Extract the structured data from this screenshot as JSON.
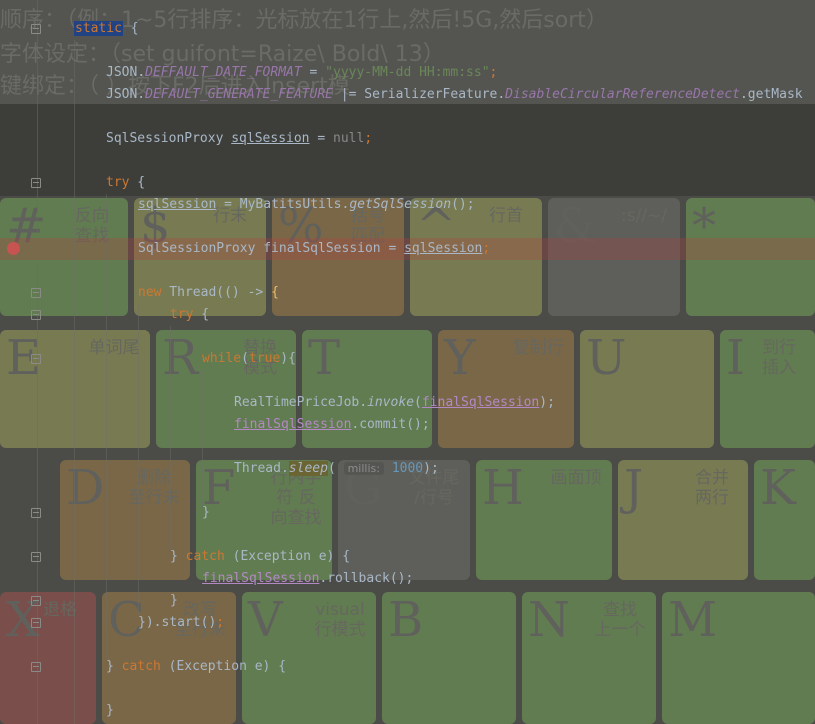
{
  "wallpaper": {
    "notes": [
      "顺序：（例：1~5行排序：光标放在1行上,然后!5G,然后sort）",
      "字体设定：（set guifont=Raize\\ Bold\\ 13）",
      "键绑定：（                                    ）按下F2后进入Insert模"
    ],
    "keys": [
      {
        "char": "#",
        "label": "反向 查找",
        "color": "k-green"
      },
      {
        "char": "$",
        "label": "行末",
        "color": "k-yellow"
      },
      {
        "char": "%",
        "label": "括号 匹配",
        "color": "k-orange"
      },
      {
        "char": "^",
        "label": "行首",
        "color": "k-yellow"
      },
      {
        "char": "&",
        "label": ":s//~/",
        "color": "k-gray"
      },
      {
        "char": "*",
        "label": "",
        "color": "k-green"
      },
      {
        "char": "E",
        "label": "单词尾",
        "color": "k-yellow"
      },
      {
        "char": "R",
        "label": "替换 模式",
        "color": "k-green"
      },
      {
        "char": "T",
        "label": "",
        "color": "k-green"
      },
      {
        "char": "Y",
        "label": "复制行",
        "color": "k-orange"
      },
      {
        "char": "U",
        "label": "",
        "color": "k-yellow"
      },
      {
        "char": "I",
        "label": "到行 插入",
        "color": "k-green"
      },
      {
        "char": "D",
        "label": "删除 至行末",
        "color": "k-orange"
      },
      {
        "char": "F",
        "label": "行内字符 反向查找",
        "color": "k-green"
      },
      {
        "char": "G",
        "label": "文件尾 /行号",
        "color": "k-gray"
      },
      {
        "char": "H",
        "label": "画面顶",
        "color": "k-green"
      },
      {
        "char": "J",
        "label": "合并 两行",
        "color": "k-yellow"
      },
      {
        "char": "K",
        "label": "",
        "color": "k-green"
      },
      {
        "char": "X",
        "label": "退格",
        "color": "k-red"
      },
      {
        "char": "C",
        "label": "改写 至行末",
        "color": "k-orange"
      },
      {
        "char": "V",
        "label": "visual 行模式",
        "color": "k-green"
      },
      {
        "char": "B",
        "label": "",
        "color": "k-green"
      },
      {
        "char": "N",
        "label": "查找 上一个",
        "color": "k-green"
      },
      {
        "char": "M",
        "label": "",
        "color": "k-green"
      }
    ]
  },
  "editor": {
    "code": {
      "static_kw": "static",
      "open_brace": " {",
      "l2_a": "JSON.",
      "l2_field": "DEFFAULT_DATE_FORMAT",
      "l2_b": " = ",
      "l2_str": "\"yyyy-MM-dd HH:mm:ss\"",
      "l2_c": ";",
      "l3_a": "JSON.",
      "l3_field": "DEFAULT_GENERATE_FEATURE",
      "l3_b": " |= SerializerFeature.",
      "l3_field2": "DisableCircularReferenceDetect",
      "l3_c": ".getMask",
      "l4_a": "SqlSessionProxy ",
      "l4_var": "sqlSession",
      "l4_b": " = ",
      "l4_null": "null",
      "l4_c": ";",
      "l5_kw": "try",
      "l5_b": " {",
      "l6_var": "sqlSession",
      "l6_b": " = MyBatitsUtils.",
      "l6_call": "getSqlSession",
      "l6_c": "();",
      "l7_a": "SqlSessionProxy finalSqlSession = ",
      "l7_var": "sqlSession",
      "l7_c": ";",
      "l8_kw": "new",
      "l8_b": " Thread(() -> ",
      "l8_brace": "{",
      "l9_kw": "try",
      "l9_b": " {",
      "l10_kw": "while",
      "l10_b": "(",
      "l10_true": "true",
      "l10_c": "){",
      "l11_a": "RealTimePriceJob.",
      "l11_call": "invoke",
      "l11_b": "(",
      "l11_var": "finalSqlSession",
      "l11_c": ");",
      "l12_var": "finalSqlSession",
      "l12_b": ".commit();",
      "l13_a": "Thread.",
      "l13_call": "sleep",
      "l13_b": "( ",
      "l13_hint": "millis:",
      "l13_num": "1000",
      "l13_c": ");",
      "l14": "}",
      "l15_a": "} ",
      "l15_kw": "catch",
      "l15_b": " (Exception e) {",
      "l16_var": "finalSqlSession",
      "l16_b": ".rollback();",
      "l17": "}",
      "l18_a": "}).start()",
      "l18_c": ";",
      "l19_a": "} ",
      "l19_kw": "catch",
      "l19_b": " (Exception e) {",
      "l20": "}"
    }
  },
  "colors": {
    "keyword": "#cc7832",
    "string": "#6a8759",
    "number": "#6897bb",
    "static_field": "#9876aa",
    "default_text": "#a9b7c6",
    "breakpoint": "#c75450"
  }
}
